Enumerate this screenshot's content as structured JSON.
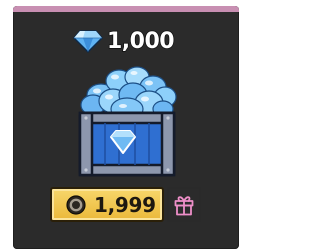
{
  "offer": {
    "amount": "1,000",
    "currency_icon": "diamond-icon",
    "image": "diamond-chest-icon"
  },
  "purchase": {
    "price": "1,999",
    "price_icon": "coin-icon",
    "gift_icon": "gift-icon"
  },
  "colors": {
    "card_background": "#2b2b2b",
    "top_accent": "#c88fb2",
    "button_gold": "#f1c14c",
    "diamond_blue": "#5fb2f2",
    "chest_blue": "#2f6fd1",
    "gift_pink": "#ee8fc8"
  }
}
